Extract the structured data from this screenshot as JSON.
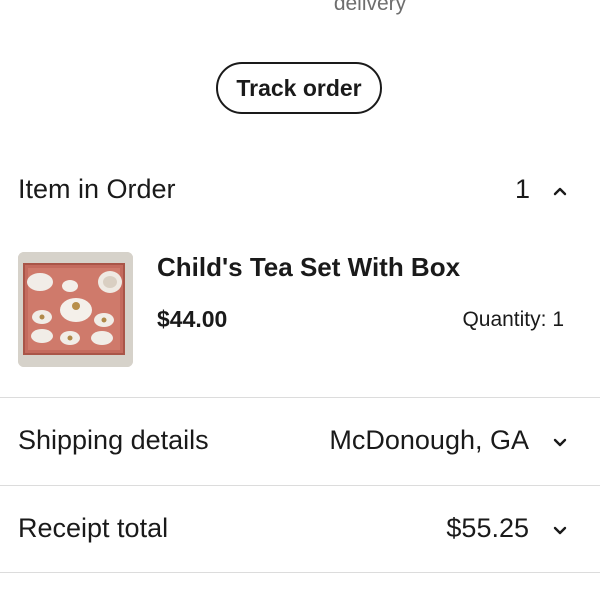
{
  "top_text": "delivery",
  "track_order_label": "Track order",
  "items_section": {
    "title": "Item in Order",
    "count": "1"
  },
  "item": {
    "title": "Child's Tea Set With Box",
    "price": "$44.00",
    "quantity": "Quantity: 1"
  },
  "shipping": {
    "title": "Shipping details",
    "value": "McDonough, GA"
  },
  "receipt": {
    "title": "Receipt total",
    "value": "$55.25"
  },
  "icons": {
    "items_toggle": "chevron-up-icon",
    "shipping_toggle": "chevron-down-icon",
    "receipt_toggle": "chevron-down-icon"
  },
  "colors": {
    "text": "#1a1a1a",
    "muted": "#6e6e6e",
    "divider": "#dcdcdc"
  }
}
